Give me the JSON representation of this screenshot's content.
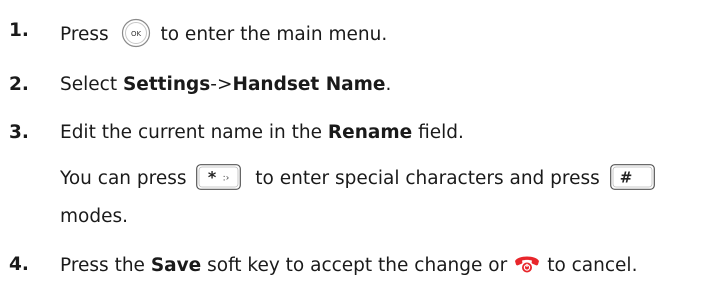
{
  "steps": [
    {
      "number": "1.",
      "pre": "Press",
      "icon": "ok-key-icon",
      "post": "to enter the main menu."
    },
    {
      "number": "2.",
      "pre": "Select ",
      "bold1": "Settings",
      "mid": "->",
      "bold2": "Handset Name",
      "post": "."
    },
    {
      "number": "3.",
      "pre": "Edit the current name in the ",
      "bold": "Rename",
      "post": " field.",
      "note_pre": "You can press",
      "note_icon1": "star-key-icon",
      "note_mid": "to enter special characters and press",
      "note_icon2": "hash-key-icon",
      "note_cont": "modes."
    },
    {
      "number": "4.",
      "pre": "Press the ",
      "bold": "Save",
      "mid": " soft key to accept the change or",
      "icon": "end-call-key-icon",
      "post": "to cancel."
    }
  ],
  "colors": {
    "text": "#1a1a1a",
    "end_call_red": "#e8262b"
  }
}
